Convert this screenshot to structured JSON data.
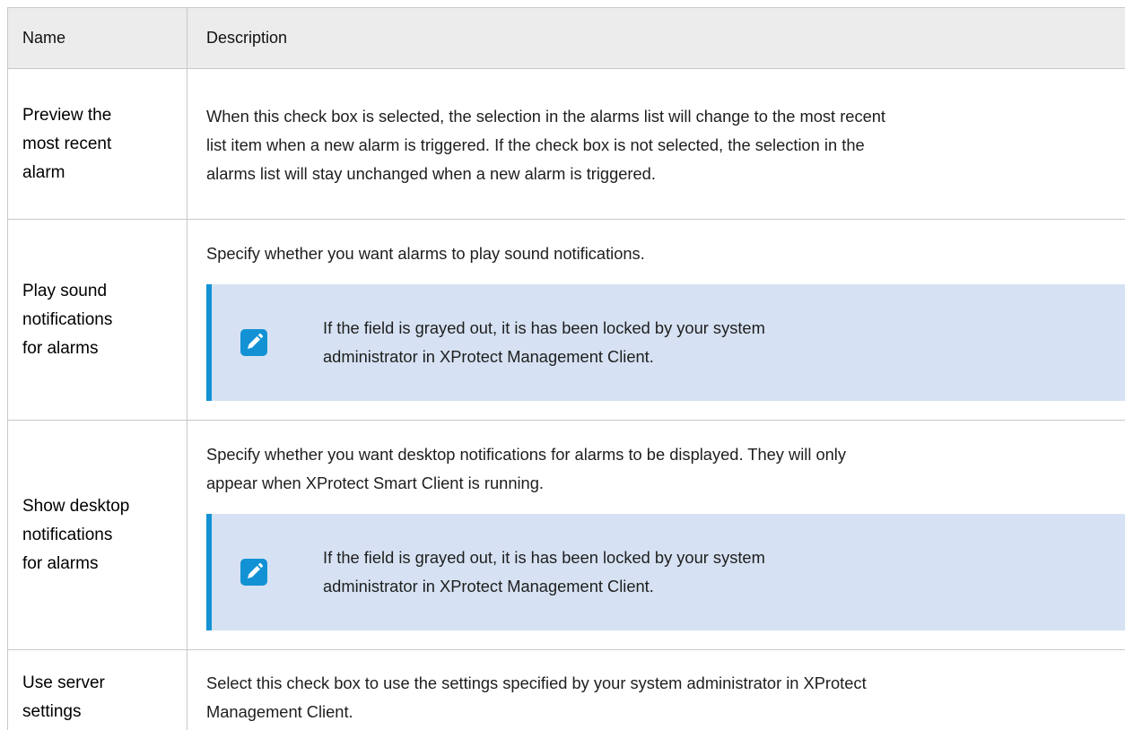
{
  "table": {
    "headers": {
      "name": "Name",
      "description": "Description"
    },
    "rows": [
      {
        "name_lines": [
          "Preview the",
          "most recent",
          "alarm"
        ],
        "description_lines": [
          "When this check box is selected, the selection in the alarms list will change to the most recent",
          "list item when a new alarm is triggered. If the check box is not selected, the selection in the",
          "alarms list will stay unchanged when a new alarm is triggered."
        ]
      },
      {
        "name_lines": [
          "Play sound",
          "notifications",
          "for alarms"
        ],
        "description_lines": [
          "Specify whether you want alarms to play sound notifications."
        ],
        "note": {
          "icon": "pencil-icon",
          "lines": [
            "If the field is grayed out, it is has been locked by your system",
            "administrator in XProtect Management Client."
          ]
        }
      },
      {
        "name_lines": [
          "Show desktop",
          "notifications",
          "for alarms"
        ],
        "description_lines": [
          "Specify whether you want desktop notifications for alarms to be displayed. They will only",
          "appear when XProtect Smart Client is running."
        ],
        "note": {
          "icon": "pencil-icon",
          "lines": [
            "If the field is grayed out, it is has been locked by your system",
            "administrator in XProtect Management Client."
          ]
        }
      },
      {
        "name_lines": [
          "Use server",
          "settings"
        ],
        "description_lines": [
          "Select this check box to use the settings specified by your system administrator in XProtect",
          "Management Client."
        ]
      }
    ]
  },
  "colors": {
    "header_bg": "#ececec",
    "note_bg": "#d6e2f3",
    "note_accent": "#1292d4"
  }
}
